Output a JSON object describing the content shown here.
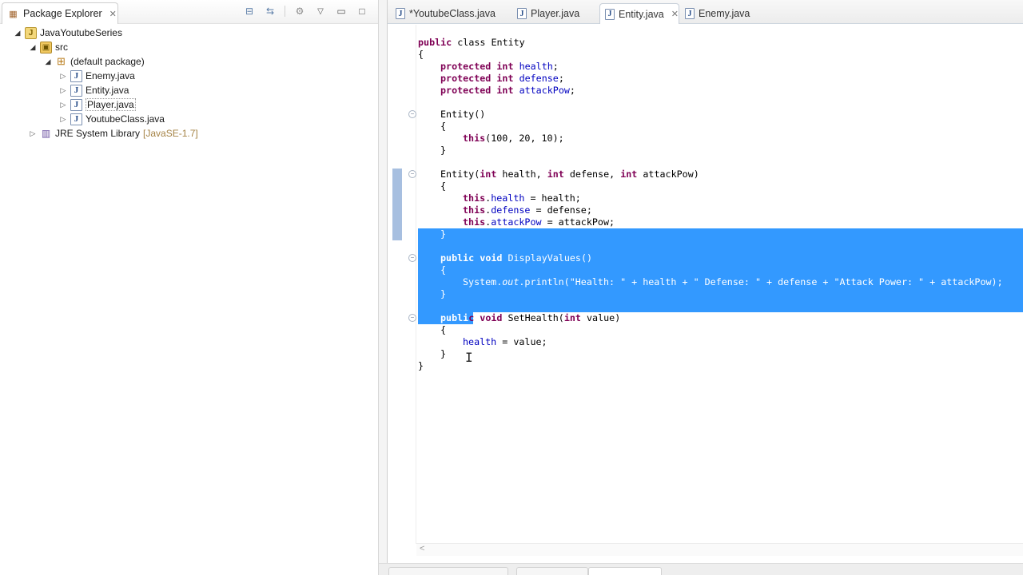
{
  "explorer": {
    "title": "Package Explorer",
    "tree": [
      {
        "label": "JavaYoutubeSeries",
        "icon": "project-icon"
      },
      {
        "label": "src",
        "icon": "source-folder-icon"
      },
      {
        "label": "(default package)",
        "icon": "package-icon"
      },
      {
        "label": "Enemy.java",
        "icon": "java-file-icon"
      },
      {
        "label": "Entity.java",
        "icon": "java-file-icon"
      },
      {
        "label": "Player.java",
        "icon": "java-file-icon"
      },
      {
        "label": "YoutubeClass.java",
        "icon": "java-file-icon"
      },
      {
        "label": "JRE System Library",
        "decoration": "[JavaSE-1.7]",
        "icon": "library-icon"
      }
    ]
  },
  "editor": {
    "tabs": [
      {
        "label": "*YoutubeClass.java",
        "active": false
      },
      {
        "label": "Player.java",
        "active": false
      },
      {
        "label": "Entity.java",
        "active": true
      },
      {
        "label": "Enemy.java",
        "active": false
      }
    ],
    "code": {
      "l1a": "public",
      "l1b": " class Entity",
      "l2": "{",
      "l3a": "protected",
      "l3b": "int",
      "l3c": "health",
      "l3d": ";",
      "l4a": "protected",
      "l4b": "int",
      "l4c": "defense",
      "l4d": ";",
      "l5a": "protected",
      "l5b": "int",
      "l5c": "attackPow",
      "l5d": ";",
      "l6": "Entity()",
      "l7": "{",
      "l8a": "this",
      "l8b": "(100, 20, 10);",
      "l9": "}",
      "l10a": "Entity(",
      "l10b": "int",
      "l10c": " health, ",
      "l10d": "int",
      "l10e": " defense, ",
      "l10f": "int",
      "l10g": " attackPow)",
      "l11": "{",
      "l12a": "this",
      "l12b": ".",
      "l12c": "health",
      "l12d": " = health;",
      "l13a": "this",
      "l13b": ".",
      "l13c": "defense",
      "l13d": " = defense;",
      "l14a": "this",
      "l14b": ".",
      "l14c": "attackPow",
      "l14d": " = attackPow;",
      "l15": "}",
      "l16a": "public",
      "l16b": "void",
      "l16c": " DisplayValues()",
      "l17": "{",
      "l18a": "System.",
      "l18b": "out",
      "l18c": ".println(",
      "l18d": "\"Health: \"",
      "l18e": " + health + ",
      "l18f": "\" Defense: \"",
      "l18g": " + defense + ",
      "l18h": "\"Attack Power: \"",
      "l18i": " + attackPow);",
      "l19": "}",
      "l20a": "publi",
      "l20b": "c",
      "l20c": "void",
      "l20d": " SetHealth(",
      "l20e": "int",
      "l20f": " value)",
      "l21": "{",
      "l22a": "health",
      "l22b": " = value;",
      "l23": "}",
      "l24": "}"
    }
  }
}
